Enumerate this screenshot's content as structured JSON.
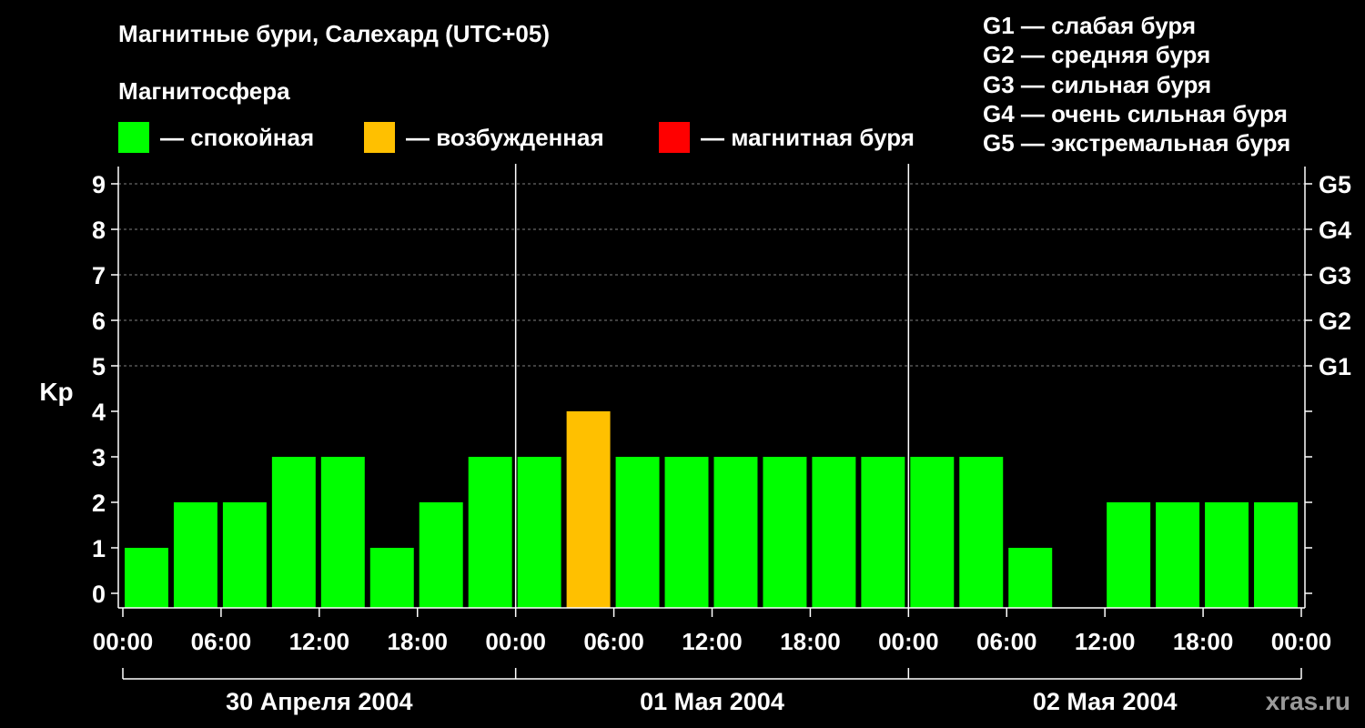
{
  "title": "Магнитные бури, Салехард (UTC+05)",
  "subtitle": "Магнитосфера",
  "legend": [
    {
      "label": "— спокойная",
      "color": "#00ff00"
    },
    {
      "label": "— возбужденная",
      "color": "#ffc000"
    },
    {
      "label": "— магнитная буря",
      "color": "#ff0000"
    }
  ],
  "storm_scale": [
    "G1 — слабая буря",
    "G2 — средняя буря",
    "G3 — сильная буря",
    "G4 — очень сильная буря",
    "G5 — экстремальная буря"
  ],
  "watermark": "xras.ru",
  "colors": {
    "quiet": "#00ff00",
    "active": "#ffc000",
    "storm": "#ff0000",
    "background": "#000000",
    "grid": "#808080"
  },
  "chart_data": {
    "type": "bar",
    "ylabel": "Kp",
    "ylim": [
      0,
      9
    ],
    "yticks": [
      "0",
      "1",
      "2",
      "3",
      "4",
      "5",
      "6",
      "7",
      "8",
      "9"
    ],
    "right_ticks": [
      {
        "value": 5,
        "label": "G1"
      },
      {
        "value": 6,
        "label": "G2"
      },
      {
        "value": 7,
        "label": "G3"
      },
      {
        "value": 8,
        "label": "G4"
      },
      {
        "value": 9,
        "label": "G5"
      }
    ],
    "xlim_hours": [
      0,
      72
    ],
    "xtick_labels": [
      "00:00",
      "06:00",
      "12:00",
      "18:00",
      "00:00",
      "06:00",
      "12:00",
      "18:00",
      "00:00",
      "06:00",
      "12:00",
      "18:00",
      "00:00"
    ],
    "days": [
      "30 Апреля 2004",
      "01 Мая 2004",
      "02 Мая 2004"
    ],
    "interval_hours": 3,
    "values": [
      1,
      2,
      2,
      3,
      3,
      1,
      2,
      3,
      3,
      4,
      3,
      3,
      3,
      3,
      3,
      3,
      3,
      3,
      1,
      0,
      2,
      2,
      2,
      2
    ],
    "categories": [
      "quiet",
      "quiet",
      "quiet",
      "quiet",
      "quiet",
      "quiet",
      "quiet",
      "quiet",
      "quiet",
      "active",
      "quiet",
      "quiet",
      "quiet",
      "quiet",
      "quiet",
      "quiet",
      "quiet",
      "quiet",
      "quiet",
      "quiet",
      "quiet",
      "quiet",
      "quiet",
      "quiet"
    ],
    "grid": true
  }
}
